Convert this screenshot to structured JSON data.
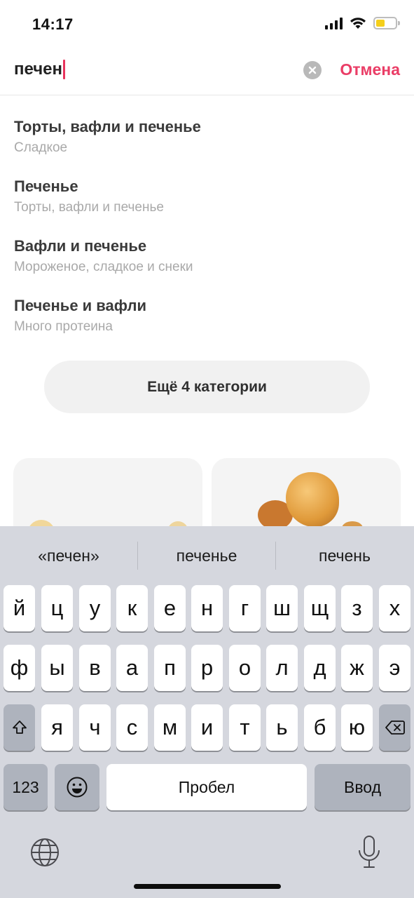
{
  "status_bar": {
    "time": "14:17",
    "icons": [
      "cellular-signal-icon",
      "wifi-icon",
      "battery-icon"
    ],
    "battery_color": "#f5cf1b"
  },
  "search": {
    "query": "печен",
    "clear_icon": "clear-icon",
    "cancel_label": "Отмена",
    "accent_color": "#ea3d66"
  },
  "results": [
    {
      "title": "Торты, вафли и печенье",
      "subtitle": "Сладкое"
    },
    {
      "title": "Печенье",
      "subtitle": "Торты, вафли и печенье"
    },
    {
      "title": "Вафли и печенье",
      "subtitle": "Мороженое, сладкое и снеки"
    },
    {
      "title": "Печенье и вафли",
      "subtitle": "Много протеина"
    }
  ],
  "more_categories_label": "Ещё 4 категории",
  "keyboard": {
    "predictions": [
      "«печен»",
      "печенье",
      "печень"
    ],
    "row1": [
      "й",
      "ц",
      "у",
      "к",
      "е",
      "н",
      "г",
      "ш",
      "щ",
      "з",
      "х"
    ],
    "row2": [
      "ф",
      "ы",
      "в",
      "а",
      "п",
      "р",
      "о",
      "л",
      "д",
      "ж",
      "э"
    ],
    "row3": [
      "я",
      "ч",
      "с",
      "м",
      "и",
      "т",
      "ь",
      "б",
      "ю"
    ],
    "numbers_label": "123",
    "space_label": "Пробел",
    "return_label": "Ввод",
    "icons": [
      "shift-icon",
      "backspace-icon",
      "emoji-icon",
      "globe-icon",
      "microphone-icon"
    ]
  }
}
